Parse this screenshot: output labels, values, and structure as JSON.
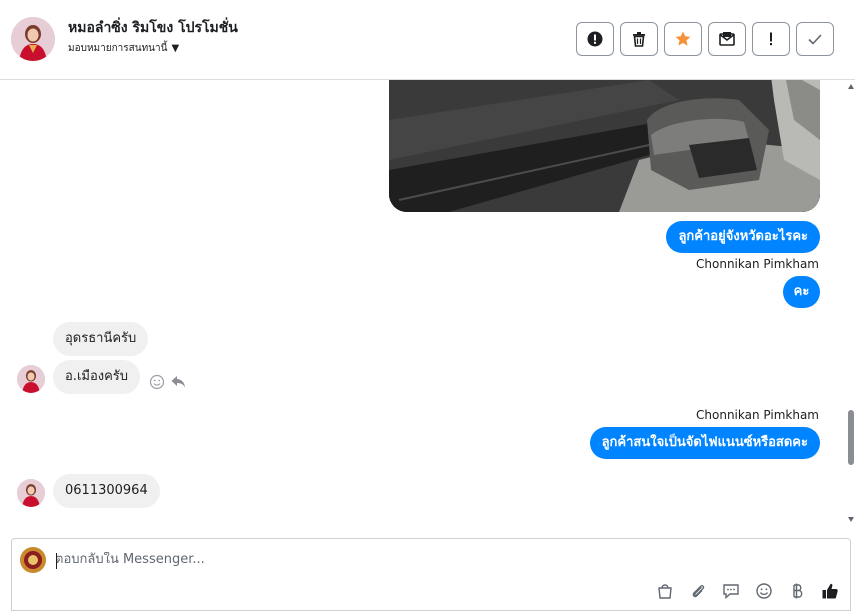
{
  "header": {
    "title": "หมอลำซิ่ง ริมโขง โปรโมชั่น",
    "assign_label": "มอบหมายการสนทนานี้"
  },
  "actions": [
    {
      "name": "spam-report-button",
      "icon": "alert-circle-icon"
    },
    {
      "name": "delete-button",
      "icon": "trash-icon"
    },
    {
      "name": "star-button",
      "icon": "star-icon"
    },
    {
      "name": "mark-unread-button",
      "icon": "mail-icon"
    },
    {
      "name": "important-button",
      "icon": "exclamation-icon"
    },
    {
      "name": "done-button",
      "icon": "check-icon"
    }
  ],
  "messages": {
    "out1": "ลูกค้าอยู่จังหวัดอะไรคะ",
    "sender1": "Chonnikan Pimkham",
    "out2": "คะ",
    "in1": "อุดรธานีครับ",
    "in2": "อ.เมืองครับ",
    "sender2": "Chonnikan Pimkham",
    "out3": "ลูกค้าสนใจเป็นจัดไฟแนนซ์หรือสดคะ",
    "in3": "0611300964"
  },
  "composer": {
    "placeholder": "ตอบกลับใน Messenger..."
  },
  "colors": {
    "outgoing_bubble": "#0084ff",
    "incoming_bubble": "#f0f0f0",
    "star": "#f7923a"
  }
}
